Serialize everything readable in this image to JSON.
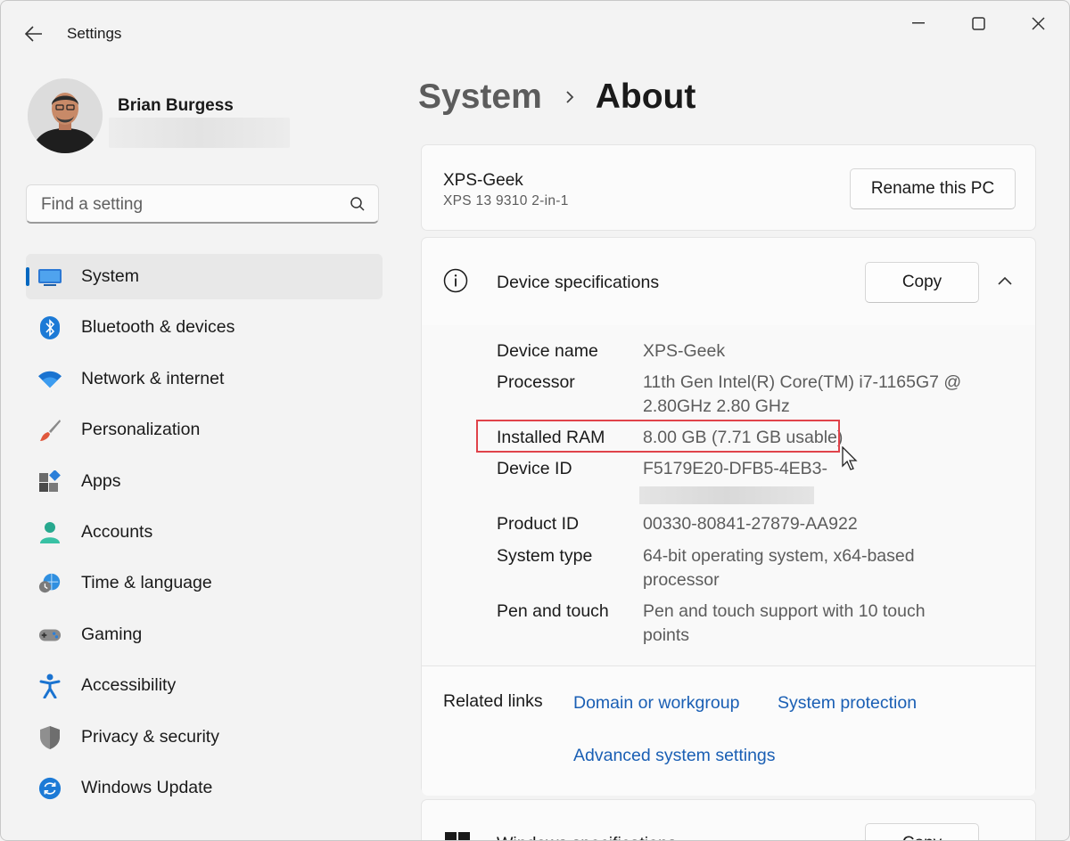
{
  "window": {
    "title": "Settings"
  },
  "profile": {
    "name": "Brian Burgess"
  },
  "search": {
    "placeholder": "Find a setting"
  },
  "nav": {
    "items": [
      {
        "label": "System",
        "icon": "system-icon",
        "selected": true
      },
      {
        "label": "Bluetooth & devices",
        "icon": "bluetooth-icon"
      },
      {
        "label": "Network & internet",
        "icon": "wifi-icon"
      },
      {
        "label": "Personalization",
        "icon": "brush-icon"
      },
      {
        "label": "Apps",
        "icon": "apps-icon"
      },
      {
        "label": "Accounts",
        "icon": "account-icon"
      },
      {
        "label": "Time & language",
        "icon": "clock-globe-icon"
      },
      {
        "label": "Gaming",
        "icon": "gamepad-icon"
      },
      {
        "label": "Accessibility",
        "icon": "accessibility-icon"
      },
      {
        "label": "Privacy & security",
        "icon": "shield-icon"
      },
      {
        "label": "Windows Update",
        "icon": "update-icon"
      }
    ]
  },
  "breadcrumb": {
    "parent": "System",
    "current": "About"
  },
  "pc": {
    "name": "XPS-Geek",
    "model": "XPS 13 9310 2-in-1",
    "rename_label": "Rename this PC"
  },
  "specs": {
    "title": "Device specifications",
    "copy_label": "Copy",
    "rows": [
      {
        "label": "Device name",
        "value": "XPS-Geek"
      },
      {
        "label": "Processor",
        "value": "11th Gen Intel(R) Core(TM) i7-1165G7 @ 2.80GHz   2.80 GHz"
      },
      {
        "label": "Installed RAM",
        "value": "8.00 GB (7.71 GB usable)"
      },
      {
        "label": "Device ID",
        "value": "F5179E20-DFB5-4EB3-"
      },
      {
        "label": "Product ID",
        "value": "00330-80841-27879-AA922"
      },
      {
        "label": "System type",
        "value": "64-bit operating system, x64-based processor"
      },
      {
        "label": "Pen and touch",
        "value": "Pen and touch support with 10 touch points"
      }
    ]
  },
  "related": {
    "title": "Related links",
    "links": [
      "Domain or workgroup",
      "System protection",
      "Advanced system settings"
    ]
  },
  "windows_specs": {
    "title": "Windows specifications",
    "copy_label": "Copy"
  },
  "colors": {
    "accent": "#0067c0",
    "link": "#1a5fb4",
    "highlight": "#e0434a"
  }
}
